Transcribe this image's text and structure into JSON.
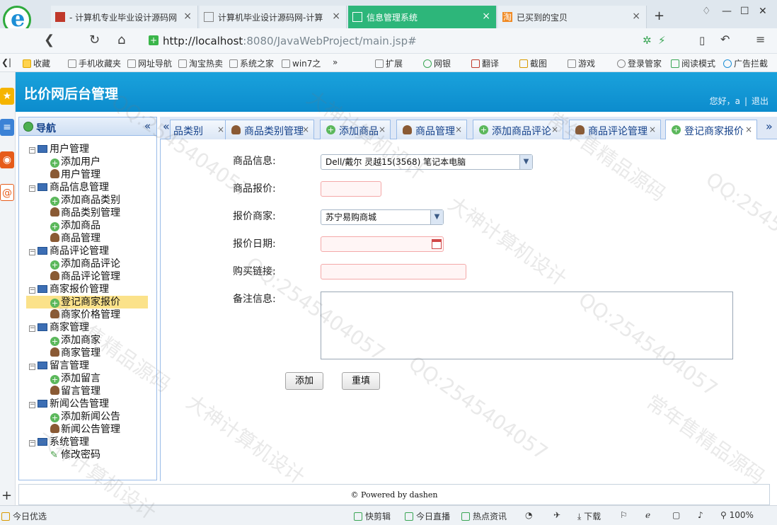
{
  "browser": {
    "tabs": [
      {
        "label": "- 计算机专业毕业设计源码网",
        "active": false
      },
      {
        "label": "计算机毕业设计源码网-计算",
        "active": false
      },
      {
        "label": "信息管理系统",
        "active": true
      },
      {
        "label": "已买到的宝贝",
        "active": false
      }
    ],
    "url_host": "http://localhost",
    "url_rest": ":8080/JavaWebProject/main.jsp#",
    "bookmarks": [
      "收藏",
      "手机收藏夹",
      "网址导航",
      "淘宝热卖",
      "系统之家",
      "win7之",
      "扩展",
      "网银",
      "翻译",
      "截图",
      "游戏",
      "登录管家",
      "阅读模式",
      "广告拦截"
    ]
  },
  "app": {
    "title": "比价网后台管理",
    "greeting": "您好，a",
    "logout": "退出"
  },
  "nav": {
    "title": "导航",
    "collapse": "«",
    "tree": [
      {
        "label": "用户管理",
        "level": 0,
        "icon": "folder"
      },
      {
        "label": "添加用户",
        "level": 1,
        "icon": "add"
      },
      {
        "label": "用户管理",
        "level": 1,
        "icon": "user"
      },
      {
        "label": "商品信息管理",
        "level": 0,
        "icon": "folder"
      },
      {
        "label": "添加商品类别",
        "level": 1,
        "icon": "add"
      },
      {
        "label": "商品类别管理",
        "level": 1,
        "icon": "user"
      },
      {
        "label": "添加商品",
        "level": 1,
        "icon": "add"
      },
      {
        "label": "商品管理",
        "level": 1,
        "icon": "user"
      },
      {
        "label": "商品评论管理",
        "level": 0,
        "icon": "folder"
      },
      {
        "label": "添加商品评论",
        "level": 1,
        "icon": "add"
      },
      {
        "label": "商品评论管理",
        "level": 1,
        "icon": "user"
      },
      {
        "label": "商家报价管理",
        "level": 0,
        "icon": "folder"
      },
      {
        "label": "登记商家报价",
        "level": 1,
        "icon": "add",
        "selected": true
      },
      {
        "label": "商家价格管理",
        "level": 1,
        "icon": "user"
      },
      {
        "label": "商家管理",
        "level": 0,
        "icon": "folder"
      },
      {
        "label": "添加商家",
        "level": 1,
        "icon": "add"
      },
      {
        "label": "商家管理",
        "level": 1,
        "icon": "user"
      },
      {
        "label": "留言管理",
        "level": 0,
        "icon": "folder"
      },
      {
        "label": "添加留言",
        "level": 1,
        "icon": "add"
      },
      {
        "label": "留言管理",
        "level": 1,
        "icon": "user"
      },
      {
        "label": "新闻公告管理",
        "level": 0,
        "icon": "folder"
      },
      {
        "label": "添加新闻公告",
        "level": 1,
        "icon": "add"
      },
      {
        "label": "新闻公告管理",
        "level": 1,
        "icon": "user"
      },
      {
        "label": "系统管理",
        "level": 0,
        "icon": "folder"
      },
      {
        "label": "修改密码",
        "level": 1,
        "icon": "pencil"
      }
    ]
  },
  "tabs": [
    {
      "label": "品类别",
      "icon": "none",
      "partial": true
    },
    {
      "label": "商品类别管理",
      "icon": "user"
    },
    {
      "label": "添加商品",
      "icon": "add"
    },
    {
      "label": "商品管理",
      "icon": "user"
    },
    {
      "label": "添加商品评论",
      "icon": "add"
    },
    {
      "label": "商品评论管理",
      "icon": "user"
    },
    {
      "label": "登记商家报价",
      "icon": "add",
      "active": true
    }
  ],
  "form": {
    "product_label": "商品信息:",
    "product_value": "Dell/戴尔 灵越15(3568) 笔记本电脑",
    "price_label": "商品报价:",
    "price_value": "",
    "merchant_label": "报价商家:",
    "merchant_value": "苏宁易购商城",
    "date_label": "报价日期:",
    "date_value": "",
    "link_label": "购买链接:",
    "link_value": "",
    "note_label": "备注信息:",
    "note_value": "",
    "submit": "添加",
    "reset": "重填"
  },
  "footer": {
    "powered": "© Powered by dashen"
  },
  "statusbar": {
    "left": "今日优选",
    "items": [
      "快剪辑",
      "今日直播",
      "热点资讯",
      "下载",
      "100%"
    ]
  },
  "watermarks": [
    "QQ:2545404057",
    "大神计算机设计",
    "常年售精品源码"
  ]
}
